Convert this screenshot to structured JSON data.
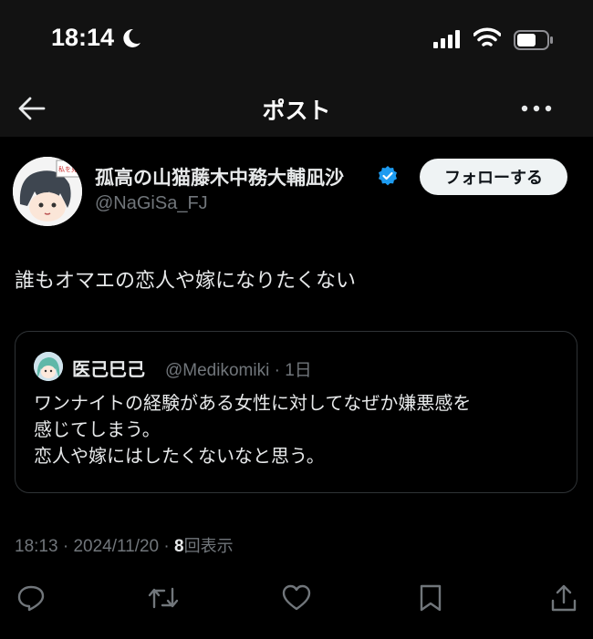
{
  "status_bar": {
    "time": "18:14"
  },
  "nav": {
    "title": "ポスト"
  },
  "author": {
    "display_name": "孤高の山猫藤木中務大輔凪沙",
    "handle": "@NaGiSa_FJ",
    "follow_label": "フォローする",
    "avatar_caption": "私を見てくれ"
  },
  "post": {
    "text": "誰もオマエの恋人や嫁になりたくない"
  },
  "quote": {
    "display_name": "医己巳己",
    "handle": "@Medikomiki",
    "time": "1日",
    "lines": [
      "ワンナイトの経験がある女性に対してなぜか嫌悪感を",
      "感じてしまう。",
      "恋人や嫁にはしたくないなと思う。"
    ]
  },
  "meta": {
    "time": "18:13",
    "date": "2024/11/20",
    "views_count": "8",
    "views_label": "回表示"
  },
  "colors": {
    "background": "#000000",
    "bar": "#121212",
    "text": "#e7e9ea",
    "secondary": "#71767b",
    "verified": "#1d9bf0",
    "border": "#2f3336"
  }
}
